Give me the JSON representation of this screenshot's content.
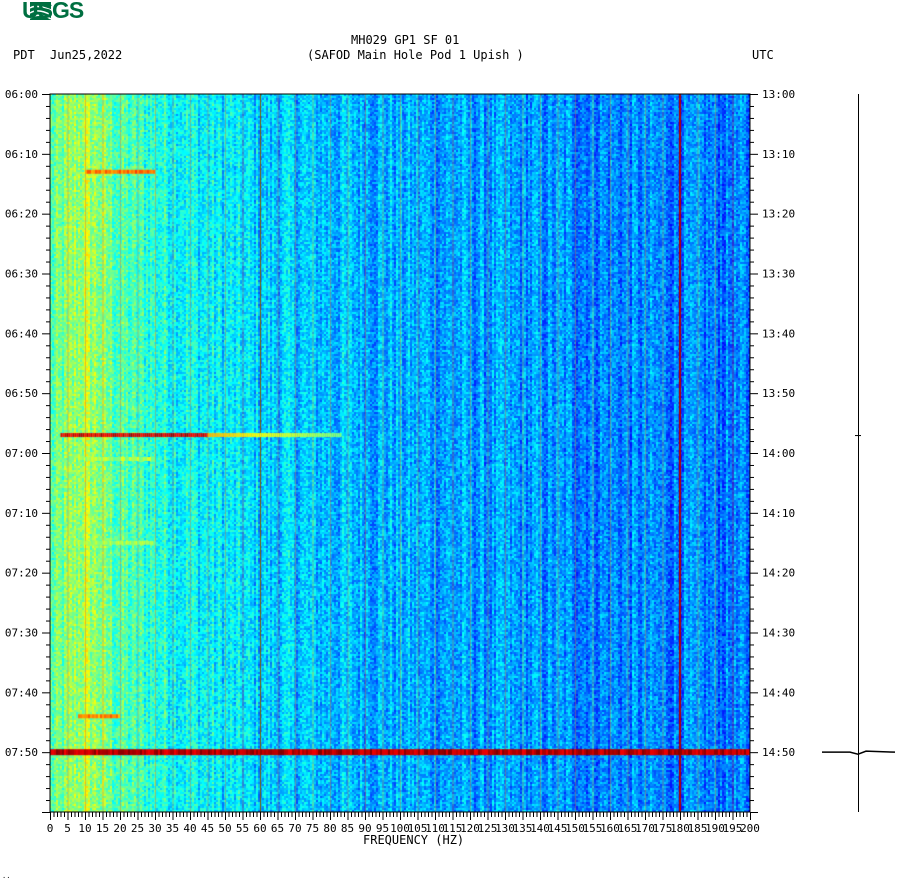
{
  "header": {
    "logo": "USGS",
    "station_title": "MH029 GP1 SF 01",
    "station_subtitle": "(SAFOD Main Hole Pod 1 Upish )",
    "left_timezone": "PDT",
    "date": "Jun25,2022",
    "right_timezone": "UTC"
  },
  "footer_mark": "..",
  "chart_data": {
    "type": "heatmap",
    "title": "MH029 GP1 SF 01 (SAFOD Main Hole Pod 1 Upish )",
    "xlabel": "FREQUENCY (HZ)",
    "ylabel_left": "PDT",
    "ylabel_right": "UTC",
    "xlim": [
      0,
      200
    ],
    "x_ticks": [
      "0",
      "5",
      "10",
      "15",
      "20",
      "25",
      "30",
      "35",
      "40",
      "45",
      "50",
      "55",
      "60",
      "65",
      "70",
      "75",
      "80",
      "85",
      "90",
      "95",
      "100",
      "105",
      "110",
      "115",
      "120",
      "125",
      "130",
      "135",
      "140",
      "145",
      "150",
      "155",
      "160",
      "165",
      "170",
      "175",
      "180",
      "185",
      "190",
      "195",
      "200"
    ],
    "y_ticks_left": [
      "06:00",
      "06:10",
      "06:20",
      "06:30",
      "06:40",
      "06:50",
      "07:00",
      "07:10",
      "07:20",
      "07:30",
      "07:40",
      "07:50"
    ],
    "y_ticks_right": [
      "13:00",
      "13:10",
      "13:20",
      "13:30",
      "13:40",
      "13:50",
      "14:00",
      "14:10",
      "14:20",
      "14:30",
      "14:40",
      "14:50"
    ],
    "time_range_minutes": 120,
    "colormap": "jet",
    "background_level_by_freq": [
      [
        0,
        0.45
      ],
      [
        10,
        0.55
      ],
      [
        20,
        0.45
      ],
      [
        40,
        0.38
      ],
      [
        60,
        0.33
      ],
      [
        120,
        0.28
      ],
      [
        200,
        0.24
      ]
    ],
    "events": [
      {
        "time_min": 13,
        "freq_range": [
          10,
          30
        ],
        "level": 0.82
      },
      {
        "time_min": 57,
        "freq_range": [
          3,
          45
        ],
        "level": 0.97,
        "tail_freq_range": [
          45,
          83
        ],
        "tail_level": 0.7
      },
      {
        "time_min": 61,
        "freq_range": [
          10,
          30
        ],
        "level": 0.6
      },
      {
        "time_min": 75,
        "freq_range": [
          5,
          30
        ],
        "level": 0.6
      },
      {
        "time_min": 104,
        "freq_range": [
          8,
          20
        ],
        "level": 0.8
      },
      {
        "time_min": 110,
        "freq_range": [
          0,
          200
        ],
        "level": 1.0
      }
    ],
    "line_frequencies": [
      60,
      180
    ],
    "harmonic_spacing_hz": 5
  }
}
